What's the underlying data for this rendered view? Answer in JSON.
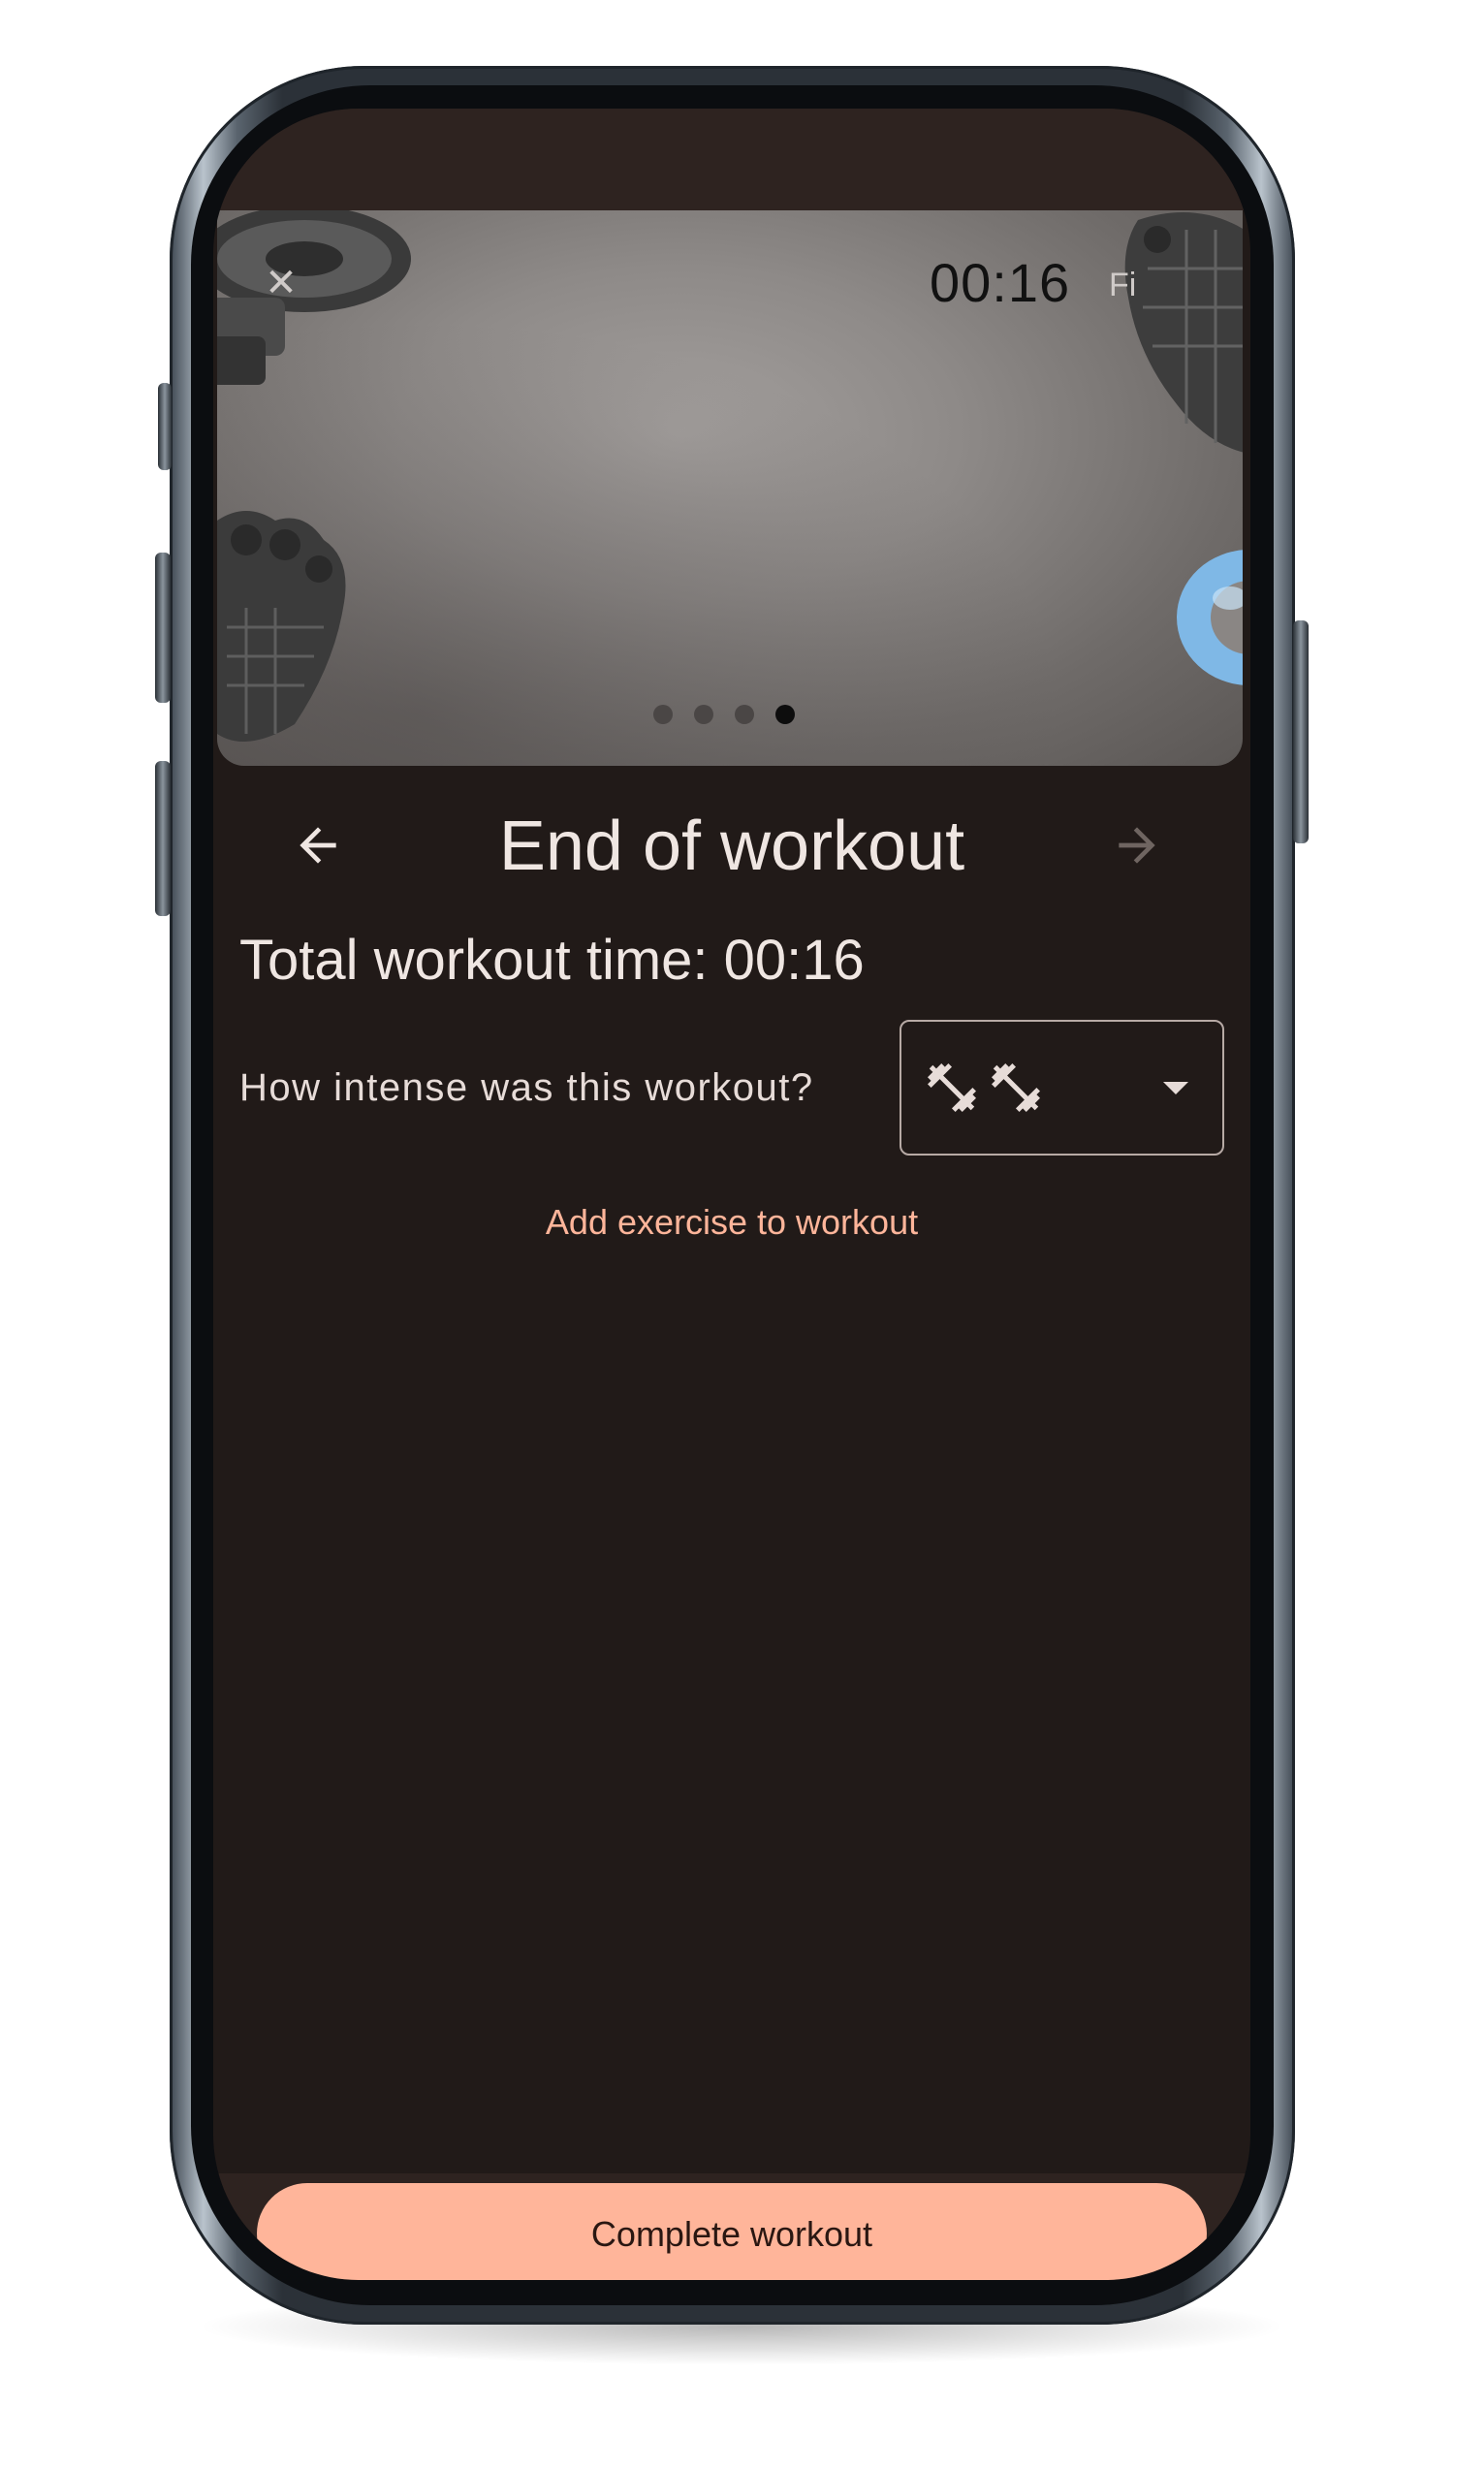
{
  "header": {
    "timer": "00:16",
    "extra_label": "Fi",
    "carousel_dot_count": 4,
    "carousel_active_index": 3
  },
  "nav": {
    "title": "End of workout"
  },
  "summary": {
    "total_time": "Total workout time: 00:16"
  },
  "intensity": {
    "question": "How intense was this workout?",
    "selected_level": 2,
    "selected_icon": "dumbbell-icon"
  },
  "actions": {
    "add_exercise": "Add exercise to workout",
    "complete": "Complete workout"
  },
  "colors": {
    "background": "#211a18",
    "surface": "#2e2320",
    "accent": "#ffb59a",
    "text_primary": "#efe6e2"
  }
}
